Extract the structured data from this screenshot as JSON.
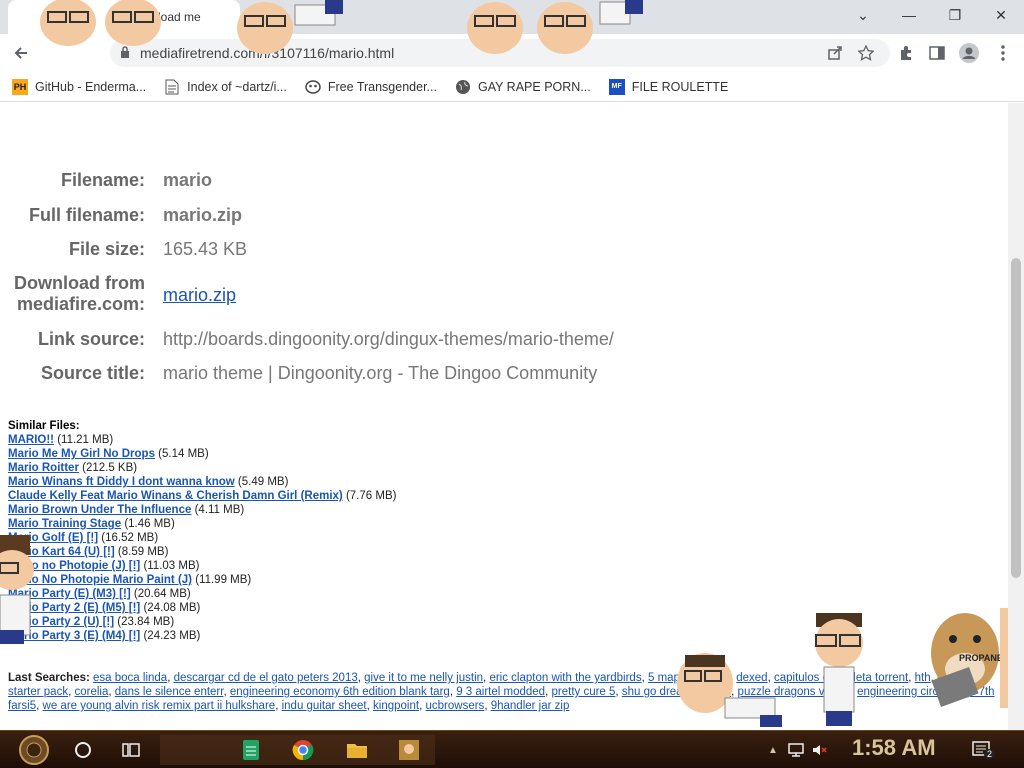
{
  "browser": {
    "tab_title": "load me",
    "url": "mediafiretrend.com/f/3107116/mario.html",
    "window_controls": {
      "minimize": "—",
      "maximize": "❐",
      "close": "✕",
      "tab_list": "⌄"
    }
  },
  "bookmarks": [
    {
      "label": "GitHub - Enderma...",
      "icon": "ph-icon"
    },
    {
      "label": "Index of ~dartz/i...",
      "icon": "page-icon"
    },
    {
      "label": "Free Transgender...",
      "icon": "mask-icon"
    },
    {
      "label": "GAY RAPE PORN...",
      "icon": "globe-icon"
    },
    {
      "label": "FILE ROULETTE",
      "icon": "file-icon"
    }
  ],
  "file_info": [
    {
      "label": "Filename:",
      "value": "mario"
    },
    {
      "label": "Full filename:",
      "value": "mario.zip"
    },
    {
      "label": "File size:",
      "value": "165.43 KB"
    },
    {
      "label": "Download from mediafire.com:",
      "value": "mario.zip"
    },
    {
      "label": "Link source:",
      "value": "http://boards.dingoonity.org/dingux-themes/mario-theme/"
    },
    {
      "label": "Source title:",
      "value": "mario theme | Dingoonity.org - The Dingoo Community"
    }
  ],
  "similar": {
    "title": "Similar Files:",
    "items": [
      {
        "name": "MARIO!!",
        "size": "(11.21 MB)"
      },
      {
        "name": "Mario Me My Girl No Drops",
        "size": "(5.14 MB)"
      },
      {
        "name": "Mario Roitter",
        "size": "(212.5 KB)"
      },
      {
        "name": "Mario Winans ft Diddy I dont wanna know",
        "size": "(5.49 MB)"
      },
      {
        "name": "Claude Kelly Feat Mario Winans & Cherish Damn Girl (Remix)",
        "size": "(7.76 MB)"
      },
      {
        "name": "Mario Brown Under The Influence",
        "size": "(4.11 MB)"
      },
      {
        "name": "Mario Training Stage",
        "size": "(1.46 MB)"
      },
      {
        "name": "Mario Golf (E) [!]",
        "size": "(16.52 MB)"
      },
      {
        "name": "Mario Kart 64 (U) [!]",
        "size": "(8.59 MB)"
      },
      {
        "name": "Mario no Photopie (J) [!]",
        "size": "(11.03 MB)"
      },
      {
        "name": "Mario No Photopie Mario Paint (J)",
        "size": "(11.99 MB)"
      },
      {
        "name": "Mario Party (E) (M3) [!]",
        "size": "(20.64 MB)"
      },
      {
        "name": "Mario Party 2 (E) (M5) [!]",
        "size": "(24.08 MB)"
      },
      {
        "name": "Mario Party 2 (U) [!]",
        "size": "(23.84 MB)"
      },
      {
        "name": "Mario Party 3 (E) (M4) [!]",
        "size": "(24.23 MB)"
      }
    ]
  },
  "last_searches": {
    "title": "Last Searches:",
    "items": [
      "esa boca linda",
      "descargar cd de el gato peters 2013",
      "give it to me nelly justin",
      "eric clapton with the yardbirds",
      "5 map",
      "eqdkpv5",
      "dexed",
      "capitulos de violeta torrent",
      "hth",
      "epsxe starter pack",
      "corelia",
      "dans le silence enterr",
      "engineering economy 6th edition blank targ",
      "9 3 airtel modded",
      "pretty cure 5",
      "shu go dream festival",
      "puzzle dragons ver4 4",
      "engineering circuit hayt 7th farsi5",
      "we are young alvin risk remix part ii hulkshare",
      "indu guitar sheet",
      "kingpoint",
      "ucbrowsers",
      "9handler jar zip"
    ]
  },
  "taskbar": {
    "clock": "1:58 AM",
    "notification_count": "2"
  },
  "colors": {
    "link": "#1a56b0",
    "label": "#666666",
    "value": "#777777"
  }
}
